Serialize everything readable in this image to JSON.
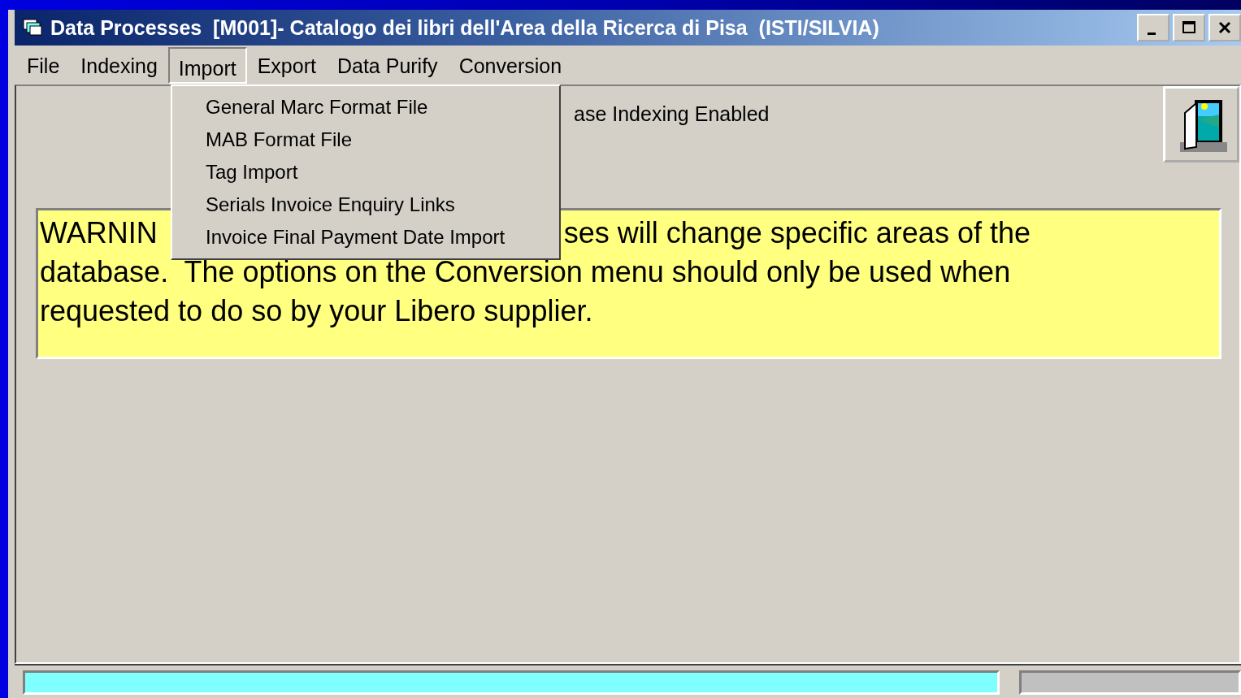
{
  "window": {
    "title": "Data Processes  [M001]- Catalogo dei libri dell'Area della Ricerca di Pisa  (ISTI/SILVIA)"
  },
  "menu": [
    {
      "label": "File",
      "selected": false
    },
    {
      "label": "Indexing",
      "selected": false
    },
    {
      "label": "Import",
      "selected": true
    },
    {
      "label": "Export",
      "selected": false
    },
    {
      "label": "Data Purify",
      "selected": false
    },
    {
      "label": "Conversion",
      "selected": false
    }
  ],
  "dropdown": {
    "items": [
      "General Marc Format File",
      "MAB Format File",
      "Tag Import",
      "Serials Invoice Enquiry Links",
      "Invoice Final Payment Date Import"
    ]
  },
  "status_label": "ase Indexing Enabled",
  "warning": {
    "first_line": [
      "WARNIN",
      "ses will change specific areas of the"
    ],
    "lines": [
      "database.  The options on the Conversion menu should only be used when",
      "requested to do so by your Libero supplier."
    ]
  },
  "status_bar": {
    "panels": [
      {
        "color": "#80ffff"
      },
      {
        "color": "#c0c0c0"
      }
    ]
  }
}
